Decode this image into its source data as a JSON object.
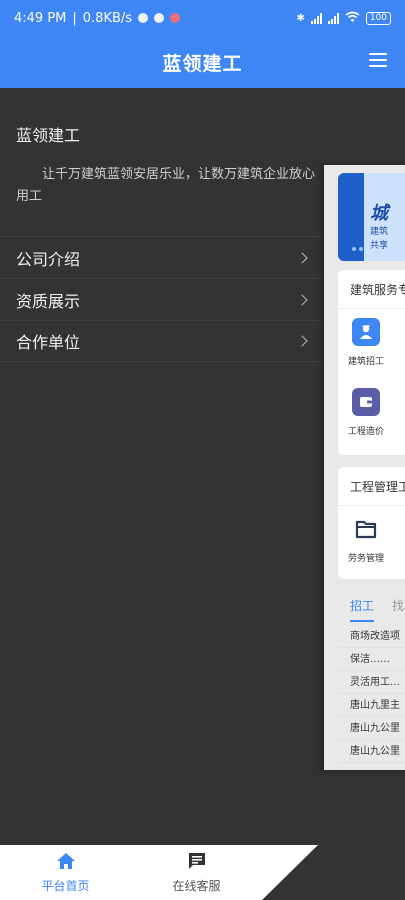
{
  "status": {
    "time": "4:49 PM",
    "speed": "0.8KB/s",
    "battery": "100"
  },
  "app": {
    "title": "蓝领建工",
    "menu_icon": "hamburger-menu-icon"
  },
  "drawer": {
    "title": "蓝领建工",
    "description": "让千万建筑蓝领安居乐业，让数万建筑企业放心用工",
    "items": [
      {
        "label": "公司介绍"
      },
      {
        "label": "资质展示"
      },
      {
        "label": "合作单位"
      }
    ]
  },
  "preview": {
    "banner_big": "城",
    "banner_line1": "建筑",
    "banner_line2": "共享",
    "services_title": "建筑服务专",
    "services": [
      {
        "label": "建筑招工",
        "icon": "worker-icon",
        "color": "#3f86f5"
      },
      {
        "label": "工程造价",
        "icon": "wallet-icon",
        "color": "#5b5ea6"
      }
    ],
    "management_title": "工程管理工",
    "management": [
      {
        "label": "劳务管理",
        "icon": "folder-icon"
      }
    ],
    "tabs": [
      "招工",
      "找"
    ],
    "jobs": [
      "商场改造项",
      "保洁……",
      "灵活用工…",
      "唐山九里主",
      "唐山九公里",
      "唐山九公里"
    ]
  },
  "bottom_nav": {
    "home_label": "平台首页",
    "service_label": "在线客服"
  },
  "colors": {
    "accent": "#3f86f5",
    "drawer_bg": "#333333"
  }
}
